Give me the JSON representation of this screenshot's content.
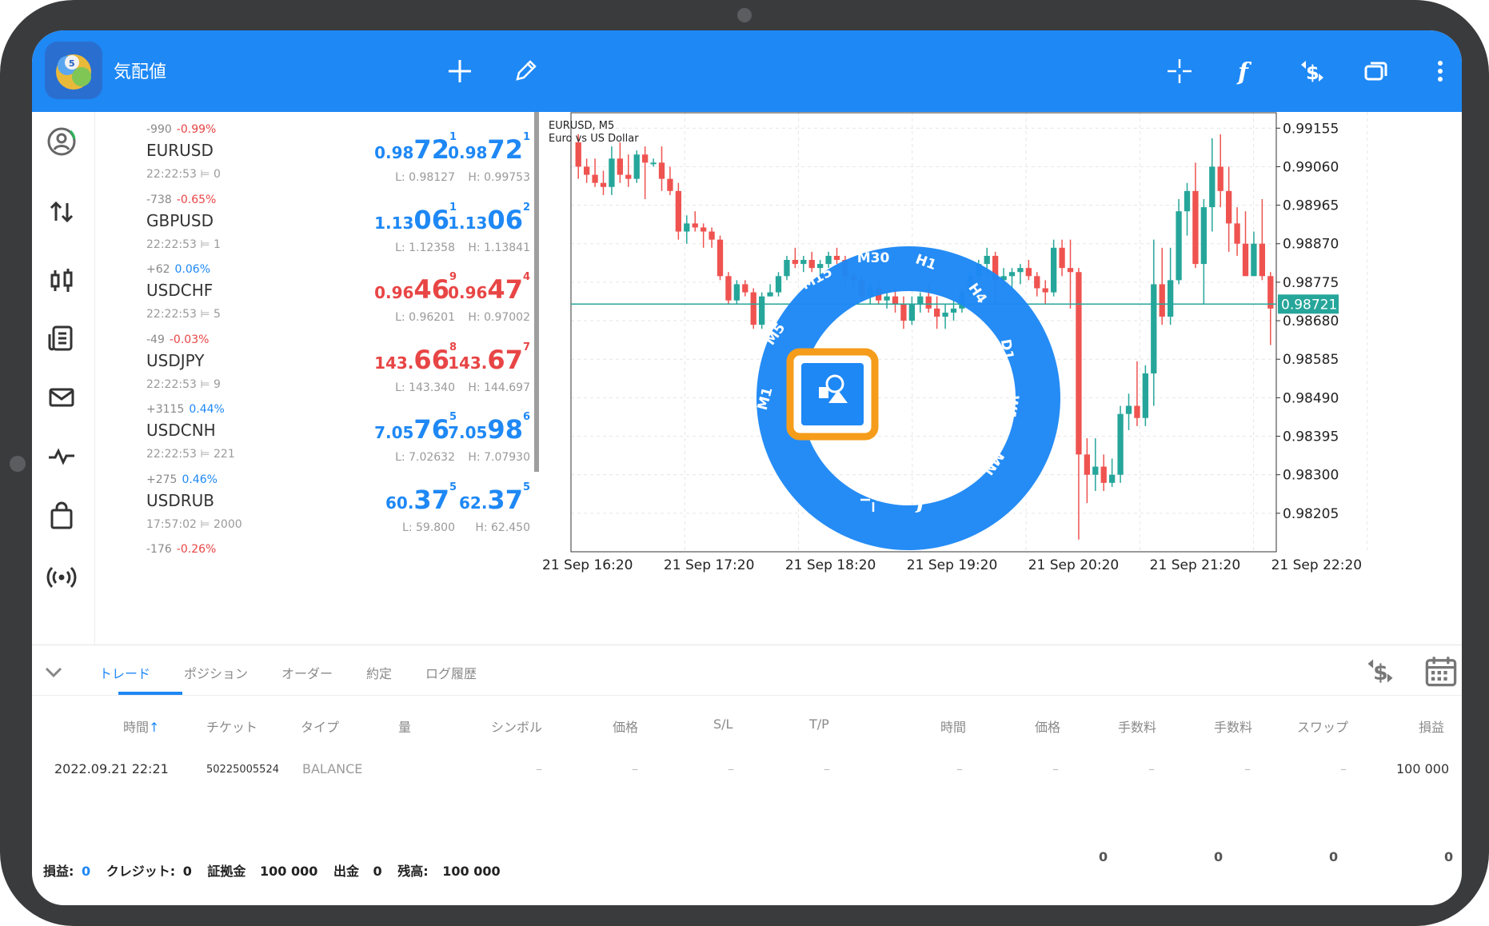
{
  "app": {
    "title": "気配値"
  },
  "quotes": [
    {
      "change": "-990",
      "pct": "-0.99%",
      "pct_color": "red",
      "symbol": "EURUSD",
      "time": "22:22:53",
      "spread": "0",
      "bid": {
        "small": "0.98",
        "big": "72",
        "sup": "1",
        "color": "blue"
      },
      "ask": {
        "small": "0.98",
        "big": "72",
        "sup": "1",
        "color": "blue"
      },
      "low": "L: 0.98127",
      "high": "H: 0.99753"
    },
    {
      "change": "-738",
      "pct": "-0.65%",
      "pct_color": "red",
      "symbol": "GBPUSD",
      "time": "22:22:53",
      "spread": "1",
      "bid": {
        "small": "1.13",
        "big": "06",
        "sup": "1",
        "color": "blue"
      },
      "ask": {
        "small": "1.13",
        "big": "06",
        "sup": "2",
        "color": "blue"
      },
      "low": "L: 1.12358",
      "high": "H: 1.13841"
    },
    {
      "change": "+62",
      "pct": "0.06%",
      "pct_color": "blue",
      "symbol": "USDCHF",
      "time": "22:22:53",
      "spread": "5",
      "bid": {
        "small": "0.96",
        "big": "46",
        "sup": "9",
        "color": "red"
      },
      "ask": {
        "small": "0.96",
        "big": "47",
        "sup": "4",
        "color": "red"
      },
      "low": "L: 0.96201",
      "high": "H: 0.97002"
    },
    {
      "change": "-49",
      "pct": "-0.03%",
      "pct_color": "red",
      "symbol": "USDJPY",
      "time": "22:22:53",
      "spread": "9",
      "bid": {
        "small": "143.",
        "big": "66",
        "sup": "8",
        "color": "red"
      },
      "ask": {
        "small": "143.",
        "big": "67",
        "sup": "7",
        "color": "red"
      },
      "low": "L: 143.340",
      "high": "H: 144.697"
    },
    {
      "change": "+3115",
      "pct": "0.44%",
      "pct_color": "blue",
      "symbol": "USDCNH",
      "time": "22:22:53",
      "spread": "221",
      "bid": {
        "small": "7.05",
        "big": "76",
        "sup": "5",
        "color": "blue"
      },
      "ask": {
        "small": "7.05",
        "big": "98",
        "sup": "6",
        "color": "blue"
      },
      "low": "L: 7.02632",
      "high": "H: 7.07930"
    },
    {
      "change": "+275",
      "pct": "0.46%",
      "pct_color": "blue",
      "symbol": "USDRUB",
      "time": "17:57:02",
      "spread": "2000",
      "bid": {
        "small": "60.",
        "big": "37",
        "sup": "5",
        "color": "blue"
      },
      "ask": {
        "small": "62.",
        "big": "37",
        "sup": "5",
        "color": "blue"
      },
      "low": "L: 59.800",
      "high": "H: 62.450"
    },
    {
      "change": "-176",
      "pct": "-0.26%",
      "pct_color": "red",
      "symbol": "",
      "time": "",
      "spread": "",
      "bid": {
        "small": "",
        "big": "",
        "sup": "",
        "color": "red"
      },
      "ask": {
        "small": "",
        "big": "",
        "sup": "",
        "color": "red"
      },
      "low": "",
      "high": ""
    }
  ],
  "chart": {
    "symbol_line": "EURUSD, M5",
    "description": "Euro vs US Dollar",
    "current_price": "0.98721",
    "price_labels": [
      "0.99155",
      "0.99060",
      "0.98965",
      "0.98870",
      "0.98775",
      "0.98680",
      "0.98585",
      "0.98490",
      "0.98395",
      "0.98300",
      "0.98205"
    ],
    "time_labels": [
      "21 Sep 16:20",
      "21 Sep 17:20",
      "21 Sep 18:20",
      "21 Sep 19:20",
      "21 Sep 20:20",
      "21 Sep 21:20",
      "21 Sep 22:20"
    ],
    "colors": {
      "up": "#26a69a",
      "down": "#ef5350",
      "current_line": "#26a69a"
    }
  },
  "chart_data": {
    "type": "candlestick",
    "ylim": [
      0.9811,
      0.99195
    ],
    "candles": [
      [
        0.9912,
        0.9914,
        0.9903,
        0.9906
      ],
      [
        0.9906,
        0.9908,
        0.9902,
        0.9904
      ],
      [
        0.9904,
        0.9908,
        0.9901,
        0.9902
      ],
      [
        0.9902,
        0.9905,
        0.9899,
        0.9901
      ],
      [
        0.9901,
        0.9911,
        0.9899,
        0.9908
      ],
      [
        0.9908,
        0.9912,
        0.9902,
        0.9904
      ],
      [
        0.9904,
        0.9909,
        0.9901,
        0.9903
      ],
      [
        0.9903,
        0.991,
        0.9902,
        0.9909
      ],
      [
        0.9909,
        0.9911,
        0.9898,
        0.9907
      ],
      [
        0.9907,
        0.9908,
        0.9906,
        0.9907
      ],
      [
        0.9907,
        0.9911,
        0.99,
        0.9903
      ],
      [
        0.9903,
        0.9906,
        0.9899,
        0.99
      ],
      [
        0.99,
        0.9902,
        0.9888,
        0.989
      ],
      [
        0.989,
        0.9894,
        0.9887,
        0.9892
      ],
      [
        0.9892,
        0.9895,
        0.989,
        0.9891
      ],
      [
        0.9891,
        0.9892,
        0.9886,
        0.989
      ],
      [
        0.989,
        0.9891,
        0.9886,
        0.9888
      ],
      [
        0.9888,
        0.9889,
        0.9878,
        0.9879
      ],
      [
        0.9879,
        0.988,
        0.9872,
        0.9873
      ],
      [
        0.9873,
        0.9878,
        0.9872,
        0.9877
      ],
      [
        0.9877,
        0.9878,
        0.9874,
        0.9875
      ],
      [
        0.9875,
        0.9876,
        0.9866,
        0.9867
      ],
      [
        0.9867,
        0.9875,
        0.9866,
        0.9874
      ],
      [
        0.9874,
        0.9877,
        0.9874,
        0.9875
      ],
      [
        0.9875,
        0.988,
        0.9874,
        0.9879
      ],
      [
        0.9879,
        0.9884,
        0.9878,
        0.9883
      ],
      [
        0.9883,
        0.9886,
        0.9881,
        0.9882
      ],
      [
        0.9882,
        0.9884,
        0.988,
        0.9883
      ],
      [
        0.9883,
        0.9885,
        0.988,
        0.9881
      ],
      [
        0.9881,
        0.9883,
        0.9879,
        0.9882
      ],
      [
        0.9882,
        0.9885,
        0.9881,
        0.9884
      ],
      [
        0.9884,
        0.9886,
        0.9882,
        0.9883
      ],
      [
        0.9883,
        0.9884,
        0.9877,
        0.9879
      ],
      [
        0.9879,
        0.988,
        0.9876,
        0.9878
      ],
      [
        0.9878,
        0.9879,
        0.9873,
        0.9874
      ],
      [
        0.9874,
        0.9877,
        0.9872,
        0.9876
      ],
      [
        0.9876,
        0.9878,
        0.9872,
        0.9873
      ],
      [
        0.9873,
        0.9875,
        0.9871,
        0.9874
      ],
      [
        0.9874,
        0.9876,
        0.987,
        0.9872
      ],
      [
        0.9872,
        0.9874,
        0.9866,
        0.9868
      ],
      [
        0.9868,
        0.9874,
        0.9867,
        0.9872
      ],
      [
        0.9872,
        0.9875,
        0.987,
        0.9874
      ],
      [
        0.9874,
        0.9877,
        0.987,
        0.9871
      ],
      [
        0.9871,
        0.9874,
        0.9866,
        0.9869
      ],
      [
        0.9869,
        0.9872,
        0.9866,
        0.987
      ],
      [
        0.987,
        0.9873,
        0.9868,
        0.9871
      ],
      [
        0.9871,
        0.9876,
        0.987,
        0.9875
      ],
      [
        0.9875,
        0.988,
        0.9874,
        0.9879
      ],
      [
        0.9879,
        0.9883,
        0.9878,
        0.9882
      ],
      [
        0.9882,
        0.9886,
        0.9879,
        0.9884
      ],
      [
        0.9884,
        0.9885,
        0.9872,
        0.9878
      ],
      [
        0.9878,
        0.9881,
        0.9876,
        0.9879
      ],
      [
        0.9879,
        0.9881,
        0.9876,
        0.988
      ],
      [
        0.988,
        0.9882,
        0.9877,
        0.9881
      ],
      [
        0.9881,
        0.9883,
        0.9878,
        0.9879
      ],
      [
        0.9879,
        0.988,
        0.9874,
        0.9876
      ],
      [
        0.9876,
        0.9878,
        0.9872,
        0.9875
      ],
      [
        0.9875,
        0.9888,
        0.9874,
        0.9886
      ],
      [
        0.9886,
        0.9888,
        0.9879,
        0.9881
      ],
      [
        0.9881,
        0.9888,
        0.9871,
        0.988
      ],
      [
        0.988,
        0.9881,
        0.9814,
        0.9835
      ],
      [
        0.9835,
        0.9839,
        0.9823,
        0.983
      ],
      [
        0.983,
        0.9839,
        0.9826,
        0.9832
      ],
      [
        0.9832,
        0.9835,
        0.9826,
        0.9828
      ],
      [
        0.9828,
        0.9834,
        0.9827,
        0.983
      ],
      [
        0.983,
        0.9847,
        0.9828,
        0.9845
      ],
      [
        0.9845,
        0.985,
        0.9841,
        0.9847
      ],
      [
        0.9847,
        0.9858,
        0.9842,
        0.9844
      ],
      [
        0.9844,
        0.9857,
        0.9842,
        0.9855
      ],
      [
        0.9855,
        0.9888,
        0.9847,
        0.9877
      ],
      [
        0.9877,
        0.9886,
        0.9867,
        0.9869
      ],
      [
        0.9869,
        0.9886,
        0.9867,
        0.9878
      ],
      [
        0.9878,
        0.9898,
        0.9877,
        0.9895
      ],
      [
        0.9895,
        0.9902,
        0.9889,
        0.99
      ],
      [
        0.99,
        0.9907,
        0.9881,
        0.9882
      ],
      [
        0.9882,
        0.9898,
        0.9872,
        0.9896
      ],
      [
        0.9896,
        0.9913,
        0.989,
        0.9906
      ],
      [
        0.9906,
        0.9914,
        0.9896,
        0.99
      ],
      [
        0.99,
        0.9906,
        0.9885,
        0.9892
      ],
      [
        0.9892,
        0.9896,
        0.9884,
        0.9887
      ],
      [
        0.9887,
        0.9895,
        0.9879,
        0.9879
      ],
      [
        0.9879,
        0.989,
        0.9879,
        0.9887
      ],
      [
        0.9887,
        0.9898,
        0.9878,
        0.9879
      ],
      [
        0.9879,
        0.988,
        0.9862,
        0.9871
      ]
    ]
  },
  "radial_menu": {
    "timeframes": [
      "M1",
      "M5",
      "M15",
      "M30",
      "H1",
      "H4",
      "D1",
      "W1",
      "MN"
    ],
    "icons": [
      "crosshair-icon",
      "function-icon",
      "image-template-icon"
    ]
  },
  "terminal": {
    "tabs": [
      "トレード",
      "ポジション",
      "オーダー",
      "約定",
      "ログ履歴"
    ],
    "active_tab": 0,
    "headers": [
      "時間",
      "チケット",
      "タイプ",
      "量",
      "シンボル",
      "価格",
      "S/L",
      "T/P",
      "時間",
      "価格",
      "手数料",
      "手数料",
      "スワップ",
      "損益"
    ],
    "sort_arrow": "↑",
    "rows": [
      {
        "time": "2022.09.21 22:21",
        "ticket": "50225005524",
        "type": "BALANCE",
        "dash": "–",
        "profit": "100 000"
      }
    ],
    "totals": [
      "0",
      "0",
      "0",
      "0"
    ]
  },
  "footer": {
    "profit_label": "損益:",
    "profit_value": "0",
    "credit_label": "クレジット:",
    "credit_value": "0",
    "deposit_label": "証拠金",
    "deposit_value": "100 000",
    "withdraw_label": "出金",
    "withdraw_value": "0",
    "balance_label": "残高:",
    "balance_value": "100 000"
  }
}
